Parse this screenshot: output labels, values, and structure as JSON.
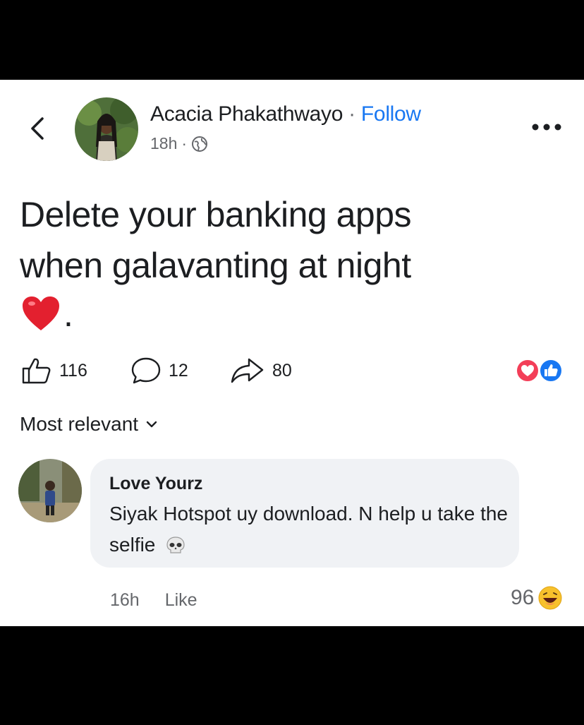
{
  "post": {
    "author": "Acacia Phakathwayo",
    "separator": "·",
    "follow_label": "Follow",
    "time": "18h",
    "meta_separator": "·",
    "text_line_1": "Delete your banking apps",
    "text_line_2": "when galavanting at night",
    "text_emoji": "heart-emoji",
    "text_end": ".",
    "likes": "116",
    "comments": "12",
    "shares": "80"
  },
  "sort": {
    "label": "Most relevant"
  },
  "comment": {
    "author": "Love Yourz",
    "text": "Siyak Hotspot uy download. N help u take the selfie",
    "emoji": "skull-emoji",
    "time": "16h",
    "like_label": "Like",
    "reaction_count": "96",
    "reaction_emoji": "laughing-emoji"
  },
  "colors": {
    "accent": "#1877f2",
    "love": "#f33e58",
    "text": "#1c1e21",
    "muted": "#65676b",
    "bubble": "#f0f2f5",
    "frame": "#000000"
  },
  "icons": [
    "back-chevron-icon",
    "globe-icon",
    "more-icon",
    "like-icon",
    "comment-icon",
    "share-icon",
    "love-reaction-icon",
    "like-reaction-icon",
    "chevron-down-icon"
  ]
}
